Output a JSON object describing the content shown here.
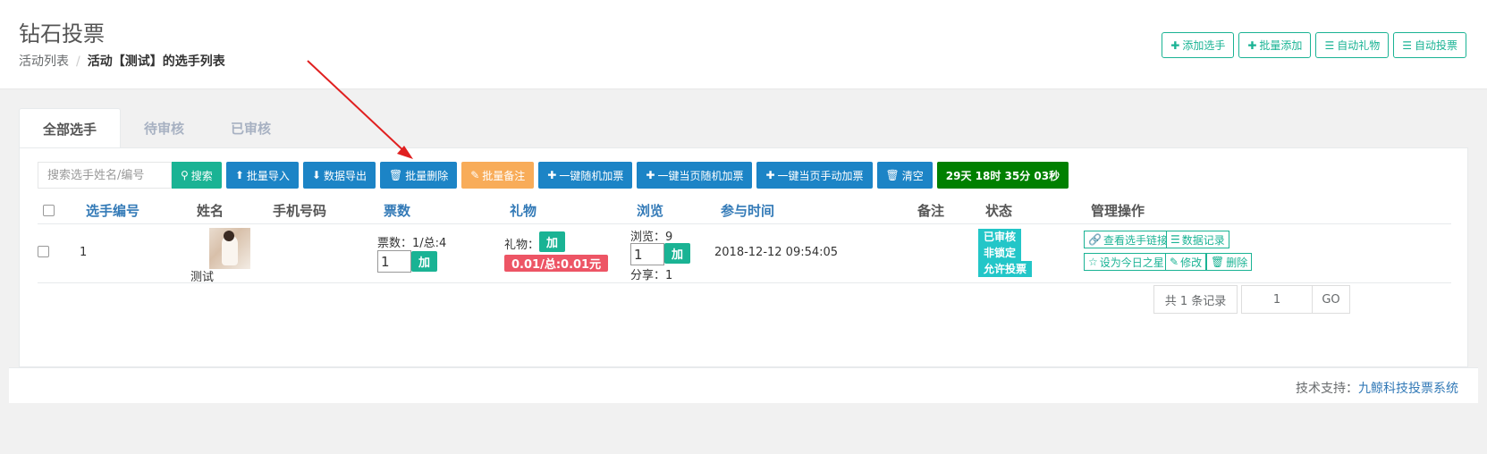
{
  "header": {
    "title": "钻石投票",
    "breadcrumb": [
      "活动列表",
      "活动【测试】的选手列表"
    ],
    "actions": [
      {
        "label": "添加选手",
        "icon": "plus-icon"
      },
      {
        "label": "批量添加",
        "icon": "plus-icon"
      },
      {
        "label": "自动礼物",
        "icon": "list-icon"
      },
      {
        "label": "自动投票",
        "icon": "list-icon"
      }
    ]
  },
  "tabs": [
    "全部选手",
    "待审核",
    "已审核"
  ],
  "toolbar": {
    "search_placeholder": "搜索选手姓名/编号",
    "search_label": "搜索",
    "import_label": "批量导入",
    "export_label": "数据导出",
    "batch_delete_label": "批量删除",
    "batch_note_label": "批量备注",
    "random_vote_label": "一键随机加票",
    "page_random_vote_label": "一键当页随机加票",
    "page_manual_vote_label": "一键当页手动加票",
    "clear_label": "清空",
    "countdown": "29天 18时 35分 03秒"
  },
  "table": {
    "headers": [
      "选手编号",
      "姓名",
      "手机号码",
      "票数",
      "礼物",
      "浏览",
      "参与时间",
      "备注",
      "状态",
      "管理操作"
    ],
    "rows": [
      {
        "id": "1",
        "name": "测试",
        "phone": "",
        "votes_text": "票数：1/总:4",
        "vote_input": "1",
        "add_label": "加",
        "gift_label": "礼物：",
        "gift_total": "0.01/总:0.01元",
        "views_text": "浏览：9",
        "view_input": "1",
        "shares_text": "分享：1",
        "joined": "2018-12-12 09:54:05",
        "note": "",
        "status": [
          "已审核",
          "非锁定",
          "允许投票"
        ],
        "ops": [
          "查看选手链接",
          "数据记录",
          "设为今日之星",
          "修改",
          "删除"
        ]
      }
    ]
  },
  "pagination": {
    "summary": "共 1 条记录",
    "page_input": "1",
    "go_label": "GO"
  },
  "footer": {
    "label": "技术支持：",
    "link": "九鲸科技投票系统"
  },
  "colors": {
    "primary": "#1ab394",
    "blue": "#1c84c6",
    "orange": "#f8ac59",
    "danger": "#ed5565",
    "info": "#23c6c8",
    "countdown": "#008000",
    "arrow": "#e02020"
  }
}
